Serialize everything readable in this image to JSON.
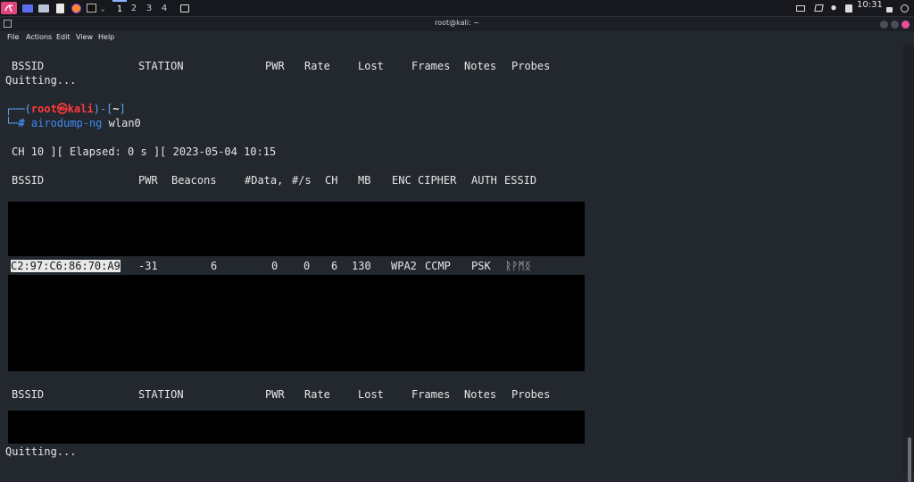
{
  "panel": {
    "workspaces": [
      "1",
      "2",
      "3",
      "4"
    ],
    "time": "10:31",
    "icons": [
      "kali-menu-icon",
      "desktop-icon",
      "files-icon",
      "text-editor-icon",
      "firefox-icon",
      "terminal-icon",
      "chevron-down-icon"
    ]
  },
  "window": {
    "title": "root@kali: ~"
  },
  "menu": {
    "file": "File",
    "actions": "Actions",
    "edit": "Edit",
    "view": "View",
    "help": "Help"
  },
  "terminal": {
    "header1": {
      "bssid": "BSSID",
      "station": "STATION",
      "pwr": "PWR",
      "rate": "Rate",
      "lost": "Lost",
      "frames": "Frames",
      "notes": "Notes",
      "probes": "Probes"
    },
    "quitting1": "Quitting...",
    "prompt": {
      "open": "┌──(",
      "user": "root㉿kali",
      "close": ")-[",
      "dir": "~",
      "end": "]",
      "hash_prefix": "└─",
      "hash": "#",
      "command": "airodump-ng",
      "arg": "wlan0"
    },
    "status_line": "CH 10 ][ Elapsed: 0 s ][ 2023-05-04 10:15",
    "header2": {
      "bssid": "BSSID",
      "pwr": "PWR",
      "beacons": "Beacons",
      "data": "#Data,",
      "s": "#/s",
      "ch": "CH",
      "mb": "MB",
      "enc": "ENC",
      "cipher": "CIPHER",
      "auth": "AUTH",
      "essid": "ESSID"
    },
    "ap_row": {
      "bssid": "C2:97:C6:86:70:A9",
      "pwr": "-31",
      "beacons": "6",
      "data": "0",
      "s": "0",
      "ch": "6",
      "mb": "130",
      "enc": "WPA2",
      "cipher": "CCMP",
      "auth": "PSK",
      "essid": "ᚱᚹᛗᛝ"
    },
    "header3": {
      "bssid": "BSSID",
      "station": "STATION",
      "pwr": "PWR",
      "rate": "Rate",
      "lost": "Lost",
      "frames": "Frames",
      "notes": "Notes",
      "probes": "Probes"
    },
    "quitting2": "Quitting..."
  },
  "colors": {
    "background": "#23272e",
    "prompt_frame": "#5fa8f5",
    "prompt_user": "#ff3b3b",
    "command": "#3d8df5",
    "redaction": "#000000"
  }
}
